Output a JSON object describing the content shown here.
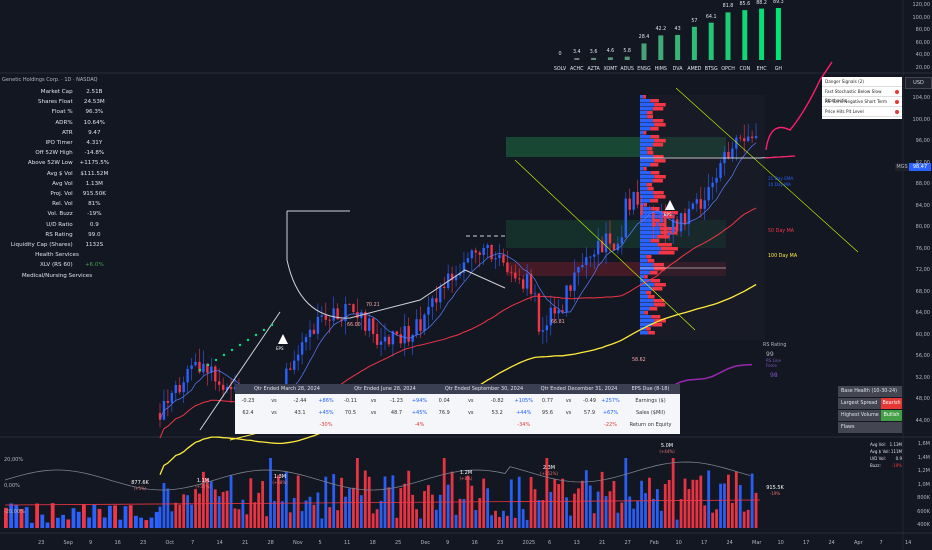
{
  "chart_title": "Genetic Holdings Corp. · 1D · NASDAQ",
  "currency": "USD",
  "stats": [
    {
      "k": "Market Cap",
      "v": "2.51B"
    },
    {
      "k": "Shares Float",
      "v": "24.53M"
    },
    {
      "k": "Float %",
      "v": "96.3%"
    },
    {
      "k": "ADR%",
      "v": "10.64%"
    },
    {
      "k": "ATR",
      "v": "9.47"
    },
    {
      "k": "IPO Timer",
      "v": "4.31Y"
    },
    {
      "k": "Off 52W High",
      "v": "-14.8%"
    },
    {
      "k": "Above 52W Low",
      "v": "+1175.5%"
    },
    {
      "k": "Avg $ Vol",
      "v": "$111.52M"
    },
    {
      "k": "Avg Vol",
      "v": "1.13M"
    },
    {
      "k": "Proj. Vol",
      "v": "915.50K"
    },
    {
      "k": "Rel. Vol",
      "v": "81%"
    },
    {
      "k": "Vol. Buzz",
      "v": "-19%"
    },
    {
      "k": "U/D Ratio",
      "v": "0.9"
    },
    {
      "k": "RS Rating",
      "v": "99.0"
    },
    {
      "k": "Liquidity Cap (Shares)",
      "v": "1132S"
    }
  ],
  "industry": "Health Services",
  "xlv_label": "XLV (RS 60)",
  "xlv_value": "+6.0%",
  "sector": "Medical/Nursing Services",
  "rs_bars": {
    "tickers": [
      "SOLV",
      "ACHC",
      "AZTA",
      "XOMT",
      "ADUS",
      "ENSG",
      "HIMS",
      "DVA",
      "AMED",
      "BTSG",
      "OPCH",
      "CON",
      "EHC",
      "GH"
    ],
    "values": [
      0,
      3.4,
      3.6,
      4.6,
      5.8,
      28.4,
      42.2,
      43,
      57,
      64.1,
      81.8,
      85.6,
      88.2,
      89.3
    ],
    "labels": [
      "0",
      "3.4",
      "3.6",
      "4.6",
      "5.8",
      "28.4",
      "42.2",
      "43",
      "57",
      "64.1",
      "81.8",
      "85.6",
      "88.2",
      "89.3"
    ]
  },
  "right_axis_top": [
    "120,00",
    "100,00",
    "80,00",
    "60,00",
    "40,00",
    "20,00"
  ],
  "right_axis_price": [
    "104,00",
    "100,00",
    "96,00",
    "92,00",
    "88,00",
    "84,00",
    "80,00",
    "76,00",
    "72,00",
    "68,00",
    "64,00",
    "60,00",
    "56,00",
    "52,00",
    "48,00",
    "44,00"
  ],
  "right_axis_vol": [
    "1,6M",
    "1,4M",
    "1,2M",
    "1,0M",
    "800K",
    "600K",
    "400K"
  ],
  "left_axis_osc": [
    "20,00%",
    "0,00%",
    "-20,00%"
  ],
  "price_tag": {
    "ticker": "MGS",
    "value": "98,47"
  },
  "ma_labels": {
    "ma50": "50 Day MA",
    "ma100": "100 Day MA",
    "ma21": "21 Day EMA",
    "ma10": "10 Day MA"
  },
  "price_annotations": [
    "66.00",
    "70.21",
    "66.81",
    "58.62"
  ],
  "rs_rating_label": "RS Rating",
  "rs_rating_value": "99",
  "rs_line_label": "RS Line Force",
  "rs_line_value": "98",
  "legend": [
    {
      "label": "Danger Signals (2)"
    },
    {
      "label": "Fast Stochastic Below Slow Stochastic"
    },
    {
      "label": "RS Turns Negative Short Term"
    },
    {
      "label": "Price Hits Pit Level"
    }
  ],
  "earnings_table": {
    "headers": [
      "Qtr Ended March 28, 2024",
      "Qtr Ended June 28, 2024",
      "Qtr Ended September 30, 2024",
      "Qtr Ended December 31, 2024",
      "EPS Due (8-18)"
    ],
    "row1": [
      "-0.23",
      "vs",
      "-2.44",
      "+86%",
      "-0.11",
      "vs",
      "-1.23",
      "+94%",
      "0.04",
      "vs",
      "-0.82",
      "+105%",
      "0.77",
      "vs",
      "-0.49",
      "+257%",
      "Earnings ($)"
    ],
    "row2": [
      "62.4",
      "vs",
      "43.1",
      "+45%",
      "70.5",
      "vs",
      "48.7",
      "+45%",
      "76.9",
      "vs",
      "53.2",
      "+44%",
      "95.6",
      "vs",
      "57.9",
      "+67%",
      "Sales ($Mil)"
    ],
    "row3": [
      "",
      "",
      "",
      "-30%",
      "",
      "",
      "",
      "-4%",
      "",
      "",
      "",
      "-34%",
      "",
      "",
      "",
      "-22%",
      "Return on Equity"
    ]
  },
  "base_health": {
    "title": "Base Health (10-30-24)",
    "rows": [
      {
        "l": "Largest Spread",
        "r": "Bearish",
        "c": "#e53935"
      },
      {
        "l": "Highest Volume",
        "r": "Bullish",
        "c": "#43a047"
      },
      {
        "l": "Flaws",
        "r": "",
        "c": "#434651"
      }
    ]
  },
  "vol_stats": [
    {
      "k": "Avg Vol:",
      "v": "1.13M"
    },
    {
      "k": "Avg $ Vol:",
      "v": "111M"
    },
    {
      "k": "U/D Vol:",
      "v": "0.9"
    },
    {
      "k": "Buzz:",
      "v": "-19%"
    }
  ],
  "volume_labels": [
    {
      "v": "877.6K",
      "p": "(+5%)"
    },
    {
      "v": "1.1M",
      "p": "(+35%)"
    },
    {
      "v": "1.3M",
      "p": "(+18%)"
    },
    {
      "v": "1.2M",
      "p": "(+8%)"
    },
    {
      "v": "2.3M",
      "p": "(+152%)"
    },
    {
      "v": "5.0M",
      "p": "(+44%)"
    },
    {
      "v": "915.5K",
      "p": "-19%"
    }
  ],
  "eps_markers": [
    "EPS",
    "EPS"
  ],
  "x_axis": [
    "23",
    "Sep",
    "9",
    "16",
    "23",
    "Oct",
    "7",
    "14",
    "21",
    "28",
    "Nov",
    "5",
    "11",
    "18",
    "25",
    "Dec",
    "9",
    "16",
    "23",
    "2025",
    "6",
    "13",
    "21",
    "27",
    "Feb",
    "10",
    "17",
    "24",
    "Mar",
    "10",
    "17",
    "24",
    "Apr",
    "7",
    "14"
  ],
  "colors": {
    "up": "#2962ff",
    "down": "#f23645",
    "ma50": "#f23645",
    "ma100": "#ffeb3b",
    "rs": "#9c27b0",
    "accent": "#00e676"
  }
}
